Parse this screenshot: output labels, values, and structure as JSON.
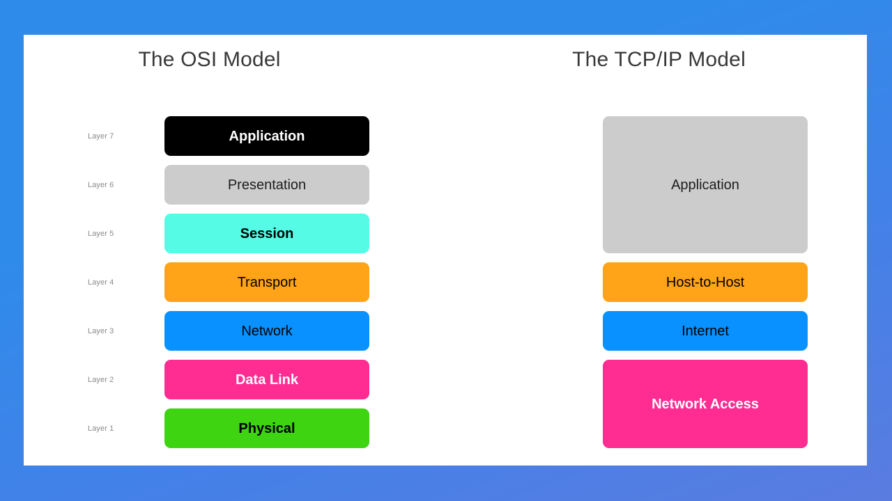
{
  "diagram": {
    "background_gradient_from": "#2f8bea",
    "background_gradient_to": "#5a7ce0",
    "card_background": "#ffffff"
  },
  "osi": {
    "title": "The OSI Model",
    "layers": [
      {
        "layer_label": "Layer 7",
        "name": "Application",
        "fill": "#000000",
        "text_color": "#ffffff",
        "weight": "bold"
      },
      {
        "layer_label": "Layer 6",
        "name": "Presentation",
        "fill": "#cccccc",
        "text_color": "#1d1d1f",
        "weight": "regular"
      },
      {
        "layer_label": "Layer 5",
        "name": "Session",
        "fill": "#55fbe5",
        "text_color": "#000000",
        "weight": "bold"
      },
      {
        "layer_label": "Layer 4",
        "name": "Transport",
        "fill": "#ffa318",
        "text_color": "#000000",
        "weight": "regular"
      },
      {
        "layer_label": "Layer 3",
        "name": "Network",
        "fill": "#0891ff",
        "text_color": "#000000",
        "weight": "regular"
      },
      {
        "layer_label": "Layer 2",
        "name": "Data Link",
        "fill": "#ff2d92",
        "text_color": "#ffffff",
        "weight": "bold"
      },
      {
        "layer_label": "Layer 1",
        "name": "Physical",
        "fill": "#3ed412",
        "text_color": "#000000",
        "weight": "bold"
      }
    ]
  },
  "tcpip": {
    "title": "The TCP/IP Model",
    "layers": [
      {
        "name": "Application",
        "fill": "#cccccc",
        "text_color": "#1d1d1f",
        "weight": "regular",
        "span": 3
      },
      {
        "name": "Host-to-Host",
        "fill": "#ffa318",
        "text_color": "#000000",
        "weight": "regular",
        "span": 1
      },
      {
        "name": "Internet",
        "fill": "#0891ff",
        "text_color": "#000000",
        "weight": "regular",
        "span": 1
      },
      {
        "name": "Network Access",
        "fill": "#ff2d92",
        "text_color": "#ffffff",
        "weight": "bold",
        "span": 2
      }
    ]
  }
}
